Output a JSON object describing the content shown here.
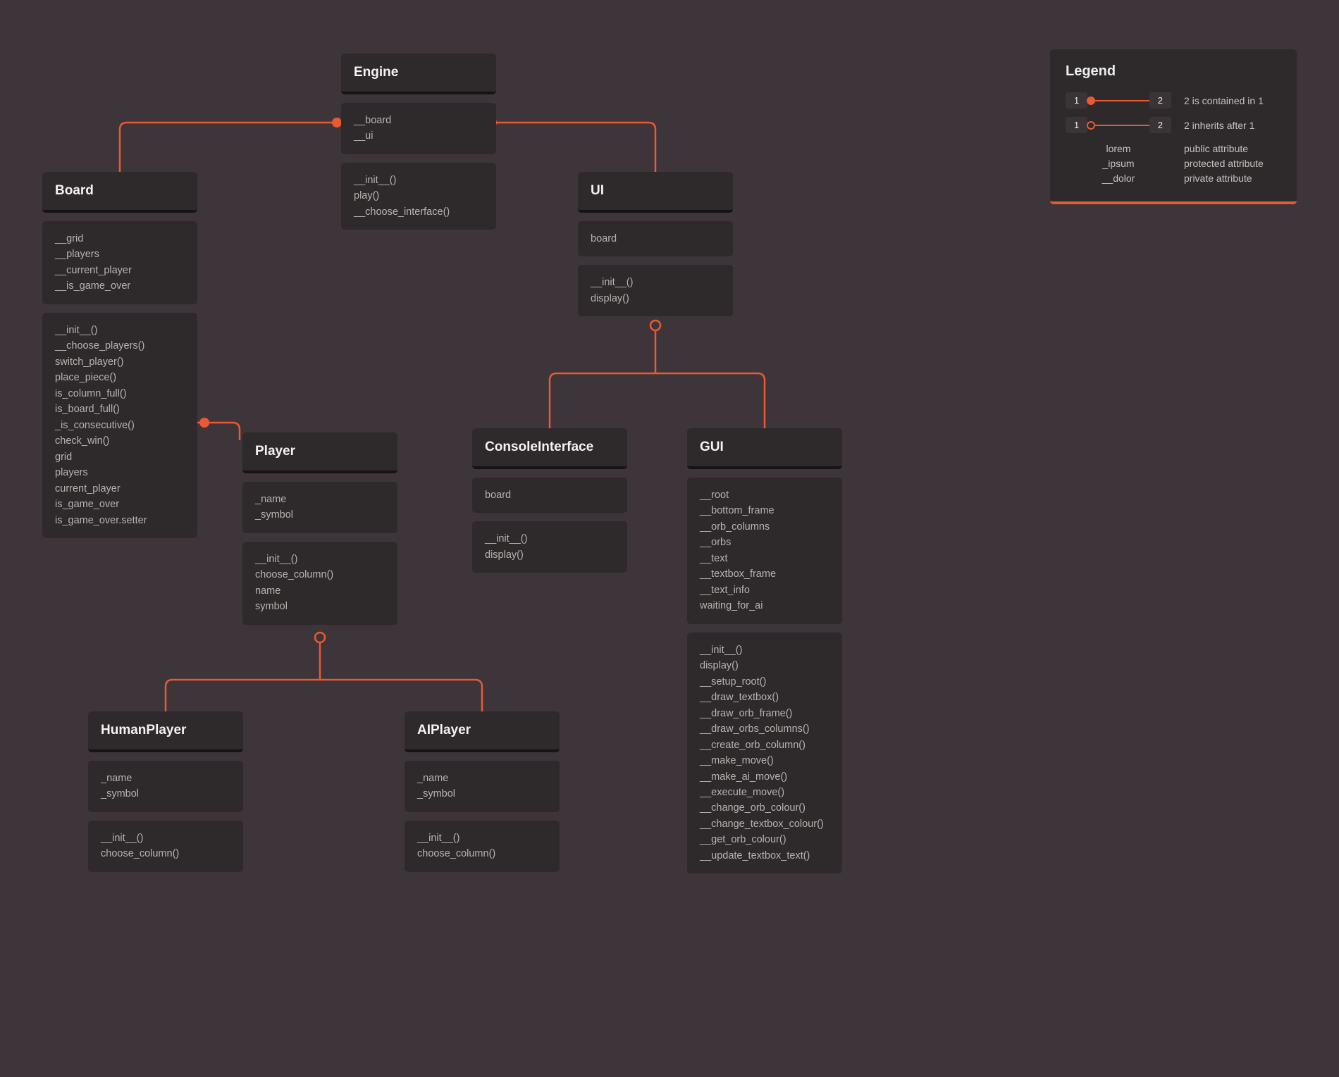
{
  "legend": {
    "title": "Legend",
    "row1": {
      "left": "1",
      "right": "2",
      "desc": "2 is contained in 1"
    },
    "row2": {
      "left": "1",
      "right": "2",
      "desc": "2 inherits after 1"
    },
    "attrs": {
      "names": [
        "lorem",
        "_ipsum",
        "__dolor"
      ],
      "descs": [
        "public attribute",
        "protected attribute",
        "private attribute"
      ]
    }
  },
  "classes": {
    "engine": {
      "name": "Engine",
      "attrs": [
        "__board",
        "__ui"
      ],
      "methods": [
        "__init__()",
        "play()",
        "__choose_interface()"
      ]
    },
    "board": {
      "name": "Board",
      "attrs": [
        "__grid",
        "__players",
        "__current_player",
        "__is_game_over"
      ],
      "methods": [
        "__init__()",
        "__choose_players()",
        "switch_player()",
        "place_piece()",
        "is_column_full()",
        "is_board_full()",
        "_is_consecutive()",
        "check_win()",
        "grid",
        "players",
        "current_player",
        "is_game_over",
        "is_game_over.setter"
      ]
    },
    "ui": {
      "name": "UI",
      "attrs": [
        "board"
      ],
      "methods": [
        "__init__()",
        "display()"
      ]
    },
    "player": {
      "name": "Player",
      "attrs": [
        "_name",
        "_symbol"
      ],
      "methods": [
        "__init__()",
        "choose_column()",
        "name",
        "symbol"
      ]
    },
    "console": {
      "name": "ConsoleInterface",
      "attrs": [
        "board"
      ],
      "methods": [
        "__init__()",
        "display()"
      ]
    },
    "gui": {
      "name": "GUI",
      "attrs": [
        "__root",
        "__bottom_frame",
        "__orb_columns",
        "__orbs",
        "__text",
        "__textbox_frame",
        "__text_info",
        "waiting_for_ai"
      ],
      "methods": [
        "__init__()",
        "display()",
        "__setup_root()",
        "__draw_textbox()",
        "__draw_orb_frame()",
        "__draw_orbs_columns()",
        "__create_orb_column()",
        "__make_move()",
        "__make_ai_move()",
        "__execute_move()",
        "__change_orb_colour()",
        "__change_textbox_colour()",
        "__get_orb_colour()",
        "__update_textbox_text()"
      ]
    },
    "human": {
      "name": "HumanPlayer",
      "attrs": [
        "_name",
        "_symbol"
      ],
      "methods": [
        "__init__()",
        "choose_column()"
      ]
    },
    "ai": {
      "name": "AIPlayer",
      "attrs": [
        "_name",
        "_symbol"
      ],
      "methods": [
        "__init__()",
        "choose_column()"
      ]
    }
  },
  "connectors": {
    "accent": "#e85a34"
  }
}
